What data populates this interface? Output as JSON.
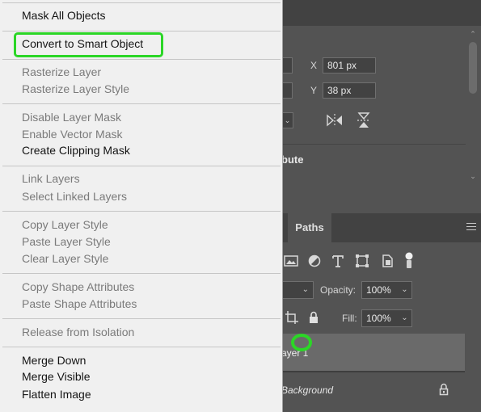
{
  "context_menu": {
    "items": [
      {
        "label": "Mask All Objects",
        "enabled": true
      },
      {
        "label": "Convert to Smart Object",
        "enabled": true,
        "highlighted": true
      },
      {
        "label": "Rasterize Layer",
        "enabled": false
      },
      {
        "label": "Rasterize Layer Style",
        "enabled": false
      },
      {
        "label": "Disable Layer Mask",
        "enabled": false
      },
      {
        "label": "Enable Vector Mask",
        "enabled": false
      },
      {
        "label": "Create Clipping Mask",
        "enabled": true
      },
      {
        "label": "Link Layers",
        "enabled": false
      },
      {
        "label": "Select Linked Layers",
        "enabled": false
      },
      {
        "label": "Copy Layer Style",
        "enabled": false
      },
      {
        "label": "Paste Layer Style",
        "enabled": false
      },
      {
        "label": "Clear Layer Style",
        "enabled": false
      },
      {
        "label": "Copy Shape Attributes",
        "enabled": false
      },
      {
        "label": "Paste Shape Attributes",
        "enabled": false
      },
      {
        "label": "Release from Isolation",
        "enabled": false
      },
      {
        "label": "Merge Down",
        "enabled": true
      },
      {
        "label": "Merge Visible",
        "enabled": true
      },
      {
        "label": "Flatten Image",
        "enabled": true
      }
    ]
  },
  "properties": {
    "x_label": "X",
    "x_value": "801 px",
    "y_label": "Y",
    "y_value": "38 px",
    "attribute_text": "bute"
  },
  "layers_panel": {
    "tab_paths": "Paths",
    "opacity_label": "Opacity:",
    "opacity_value": "100%",
    "fill_label": "Fill:",
    "fill_value": "100%",
    "layers": [
      {
        "name": "ayer 1",
        "selected": true
      },
      {
        "name": "Background",
        "locked": true
      }
    ]
  },
  "colors": {
    "highlight": "#2bd626",
    "menu_bg": "#f0f0f0",
    "panel_bg": "#535353"
  }
}
